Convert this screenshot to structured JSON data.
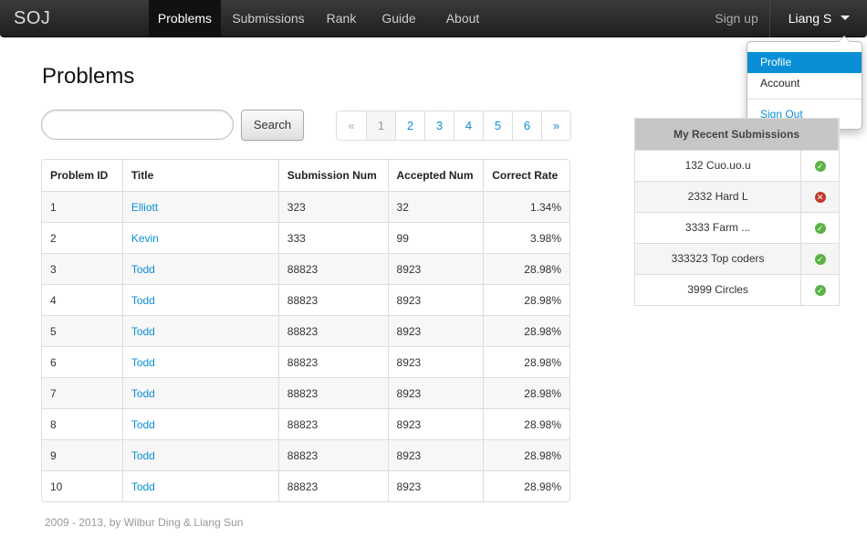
{
  "navbar": {
    "brand": "SOJ",
    "items": [
      {
        "label": "Problems",
        "active": true
      },
      {
        "label": "Submissions"
      },
      {
        "label": "Rank"
      },
      {
        "label": "Guide"
      },
      {
        "label": "About"
      }
    ],
    "signup": "Sign up",
    "user": "Liang S"
  },
  "dropdown": {
    "items": [
      "Profile",
      "Account",
      "Sign Out"
    ]
  },
  "page": {
    "title": "Problems"
  },
  "search": {
    "placeholder": "",
    "button": "Search"
  },
  "pagination": {
    "prev": "«",
    "pages": [
      "1",
      "2",
      "3",
      "4",
      "5",
      "6"
    ],
    "next": "»",
    "active_page": "1"
  },
  "problems": {
    "headers": [
      "Problem ID",
      "Title",
      "Submission Num",
      "Accepted Num",
      "Correct Rate"
    ],
    "rows": [
      [
        "1",
        "Elliott",
        "323",
        "32",
        "1.34%"
      ],
      [
        "2",
        "Kevin",
        "333",
        "99",
        "3.98%"
      ],
      [
        "3",
        "Todd",
        "88823",
        "8923",
        "28.98%"
      ],
      [
        "4",
        "Todd",
        "88823",
        "8923",
        "28.98%"
      ],
      [
        "5",
        "Todd",
        "88823",
        "8923",
        "28.98%"
      ],
      [
        "6",
        "Todd",
        "88823",
        "8923",
        "28.98%"
      ],
      [
        "7",
        "Todd",
        "88823",
        "8923",
        "28.98%"
      ],
      [
        "8",
        "Todd",
        "88823",
        "8923",
        "28.98%"
      ],
      [
        "9",
        "Todd",
        "88823",
        "8923",
        "28.98%"
      ],
      [
        "10",
        "Todd",
        "88823",
        "8923",
        "28.98%"
      ]
    ]
  },
  "recent": {
    "title": "My Recent Submissions",
    "rows": [
      {
        "name": "132 Cuo.uo.u",
        "status": "accepted"
      },
      {
        "name": "2332 Hard L",
        "status": "error"
      },
      {
        "name": "3333 Farm ...",
        "status": "accepted"
      },
      {
        "name": "333323 Top coders",
        "status": "accepted"
      },
      {
        "name": "3999 Circles",
        "status": "accepted"
      }
    ]
  },
  "footer": "2009 - 2013, by Wilbur Ding & Liang Sun",
  "colors": {
    "accent": "#0a8fd6",
    "ok": "#5bb346",
    "error": "#c0392b"
  },
  "icons": {
    "accepted": "check-circle-icon",
    "error": "x-circle-icon",
    "caret": "caret-down-icon"
  }
}
